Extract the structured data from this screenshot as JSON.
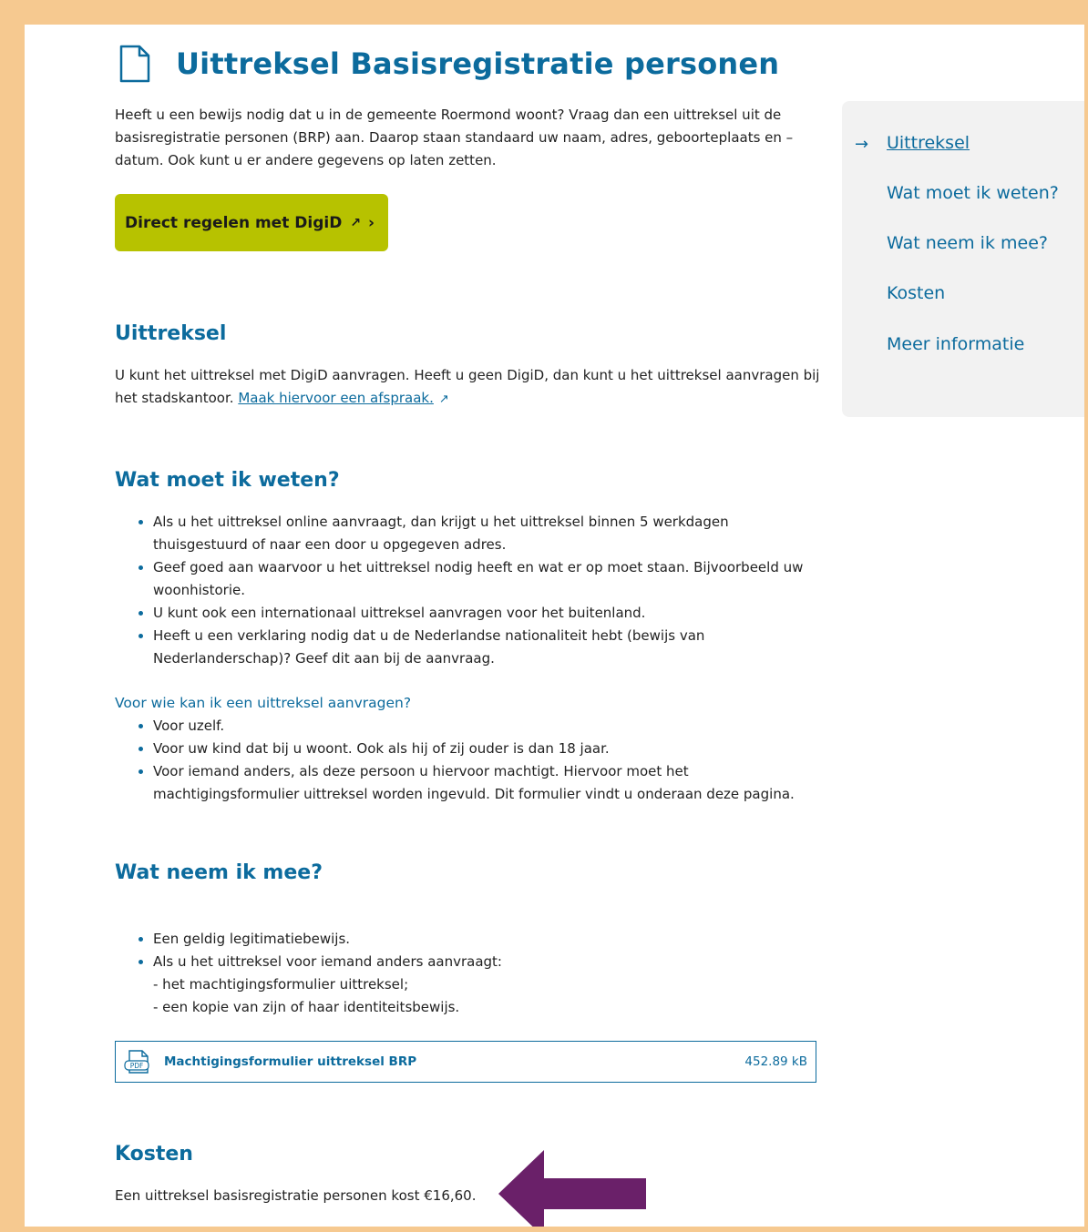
{
  "page": {
    "title": "Uittreksel Basisregistratie personen",
    "intro": "Heeft u een bewijs nodig dat u in de gemeente Roermond woont? Vraag dan een uittreksel uit de basisregistratie personen (BRP) aan. Daarop staan standaard uw naam, adres, geboorteplaats en –datum. Ook kunt u er andere gegevens op laten zetten.",
    "cta_label": "Direct regelen met DigiD",
    "cta_ext_icon": "external-link-icon",
    "cta_chevron": "›"
  },
  "uittreksel": {
    "heading": "Uittreksel",
    "text": "U kunt het uittreksel met DigiD aanvragen. Heeft u geen DigiD, dan kunt u het uittreksel aanvragen bij het stadskantoor.",
    "link_text": "Maak hiervoor een afspraak."
  },
  "weten": {
    "heading": "Wat moet ik weten?",
    "items": [
      "Als u het uittreksel online aanvraagt, dan krijgt u het uittreksel binnen 5 werkdagen thuisgestuurd of naar een door u opgegeven adres.",
      "Geef goed aan waarvoor u het uittreksel nodig heeft en wat er op moet staan. Bijvoorbeeld uw woonhistorie.",
      "U kunt ook een internationaal uittreksel aanvragen voor het buitenland.",
      "Heeft u een verklaring nodig dat u de Nederlandse nationaliteit hebt (bewijs van Nederlanderschap)? Geef dit aan bij de aanvraag."
    ],
    "subheading": "Voor wie kan ik een uittreksel aanvragen?",
    "sub_items": [
      "Voor uzelf.",
      "Voor uw kind dat bij u woont. Ook als hij of zij ouder is dan 18 jaar.",
      "Voor iemand anders, als deze persoon u hiervoor machtigt. Hiervoor moet het machtigingsformulier uittreksel  worden ingevuld. Dit formulier vindt u onderaan deze pagina."
    ]
  },
  "meenemen": {
    "heading": "Wat neem ik mee?",
    "item1": "Een geldig legitimatiebewijs.",
    "item2": "Als u het uittreksel voor iemand anders aanvraagt:",
    "item2_line1": "- het machtigingsformulier uittreksel;",
    "item2_line2": "- een kopie van zijn of haar identiteitsbewijs."
  },
  "download": {
    "icon_text": "PDF",
    "label": "Machtigingsformulier uittreksel BRP",
    "size": "452.89 kB"
  },
  "kosten": {
    "heading": "Kosten",
    "text": "Een uittreksel basisregistratie personen kost €16,60."
  },
  "sidebar": {
    "arrow": "→",
    "items": [
      {
        "label": "Uittreksel"
      },
      {
        "label": "Wat moet ik weten?"
      },
      {
        "label": "Wat neem ik mee?"
      },
      {
        "label": "Kosten"
      },
      {
        "label": "Meer informatie"
      }
    ]
  },
  "colors": {
    "frame": "#f6c990",
    "brand_blue": "#0c6b9d",
    "cta_green": "#b7c200",
    "sidebar_bg": "#f2f2f2",
    "annotation_arrow": "#6a2069"
  }
}
